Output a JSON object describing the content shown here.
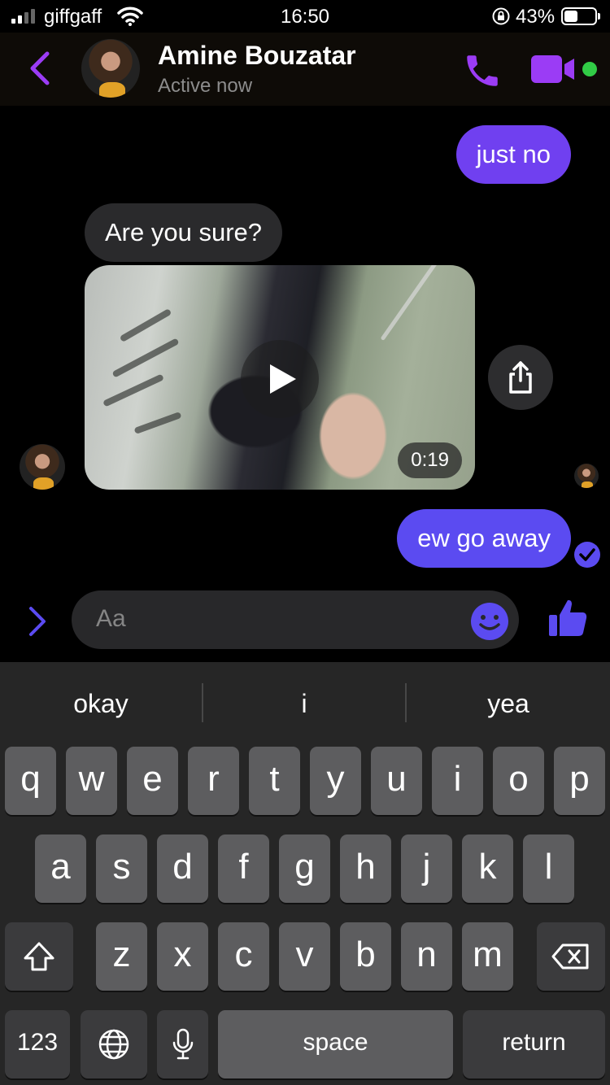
{
  "status_bar": {
    "carrier": "giffgaff",
    "time": "16:50",
    "battery_percent": "43%",
    "battery_level": 0.43
  },
  "header": {
    "contact_name": "Amine Bouzatar",
    "presence": "Active now",
    "online_color": "#31cc46",
    "accent_color": "#9b3cf5"
  },
  "messages": [
    {
      "from": "me",
      "text": "just no"
    },
    {
      "from": "contact",
      "text": "Are you sure?"
    },
    {
      "from": "contact",
      "type": "video",
      "duration": "0:19"
    },
    {
      "from": "me",
      "text": "ew go away",
      "status": "delivered"
    }
  ],
  "composer": {
    "placeholder": "Aa",
    "icons": [
      "chevron-right-icon",
      "emoji-icon",
      "thumbs-up-icon"
    ]
  },
  "keyboard": {
    "suggestions": [
      "okay",
      "i",
      "yea"
    ],
    "rows": [
      [
        "q",
        "w",
        "e",
        "r",
        "t",
        "y",
        "u",
        "i",
        "o",
        "p"
      ],
      [
        "a",
        "s",
        "d",
        "f",
        "g",
        "h",
        "j",
        "k",
        "l"
      ],
      [
        "z",
        "x",
        "c",
        "v",
        "b",
        "n",
        "m"
      ]
    ],
    "numbers_label": "123",
    "space_label": "space",
    "return_label": "return"
  }
}
